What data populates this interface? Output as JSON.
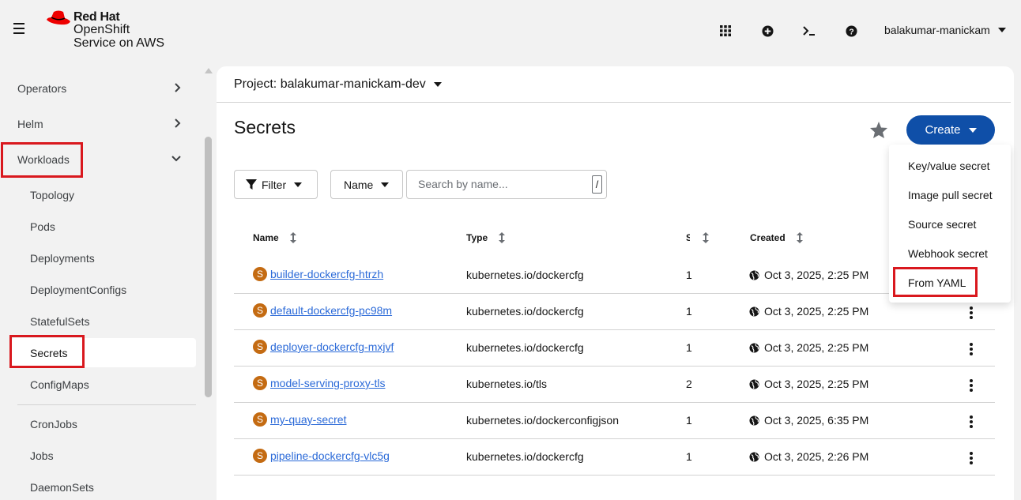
{
  "masthead": {
    "brand": "Red Hat",
    "product_line1": "OpenShift",
    "product_line2": "Service on AWS",
    "icons": [
      "app-launcher-icon",
      "add-icon",
      "terminal-icon",
      "help-icon"
    ],
    "user": "balakumar-manickam"
  },
  "sidebar": {
    "items": [
      {
        "label": "Operators"
      },
      {
        "label": "Helm"
      },
      {
        "label": "Workloads"
      },
      {
        "label": "Topology"
      },
      {
        "label": "Pods"
      },
      {
        "label": "Deployments"
      },
      {
        "label": "DeploymentConfigs"
      },
      {
        "label": "StatefulSets"
      },
      {
        "label": "Secrets"
      },
      {
        "label": "ConfigMaps"
      },
      {
        "label": "CronJobs"
      },
      {
        "label": "Jobs"
      },
      {
        "label": "DaemonSets"
      }
    ]
  },
  "project": {
    "label": "Project: balakumar-manickam-dev"
  },
  "page": {
    "title": "Secrets",
    "create_label": "Create"
  },
  "toolbar": {
    "filter_label": "Filter",
    "name_label": "Name",
    "search_placeholder": "Search by name...",
    "search_shortcut": "/"
  },
  "table": {
    "headers": {
      "name": "Name",
      "type": "Type",
      "size": "S",
      "created": "Created"
    },
    "badge": "S",
    "rows": [
      {
        "name": "builder-dockercfg-htrzh",
        "type": "kubernetes.io/dockercfg",
        "size": "1",
        "created": "Oct 3, 2025, 2:25 PM"
      },
      {
        "name": "default-dockercfg-pc98m",
        "type": "kubernetes.io/dockercfg",
        "size": "1",
        "created": "Oct 3, 2025, 2:25 PM"
      },
      {
        "name": "deployer-dockercfg-mxjvf",
        "type": "kubernetes.io/dockercfg",
        "size": "1",
        "created": "Oct 3, 2025, 2:25 PM"
      },
      {
        "name": "model-serving-proxy-tls",
        "type": "kubernetes.io/tls",
        "size": "2",
        "created": "Oct 3, 2025, 2:25 PM"
      },
      {
        "name": "my-quay-secret",
        "type": "kubernetes.io/dockerconfigjson",
        "size": "1",
        "created": "Oct 3, 2025, 6:35 PM"
      },
      {
        "name": "pipeline-dockercfg-vlc5g",
        "type": "kubernetes.io/dockercfg",
        "size": "1",
        "created": "Oct 3, 2025, 2:26 PM"
      }
    ]
  },
  "create_menu": {
    "items": [
      {
        "label": "Key/value secret"
      },
      {
        "label": "Image pull secret"
      },
      {
        "label": "Source secret"
      },
      {
        "label": "Webhook secret"
      },
      {
        "label": "From YAML"
      }
    ]
  },
  "colors": {
    "primary": "#0f4fa8",
    "link": "#2b6ad8",
    "badge": "#c46b12",
    "highlight": "#d9181e"
  }
}
